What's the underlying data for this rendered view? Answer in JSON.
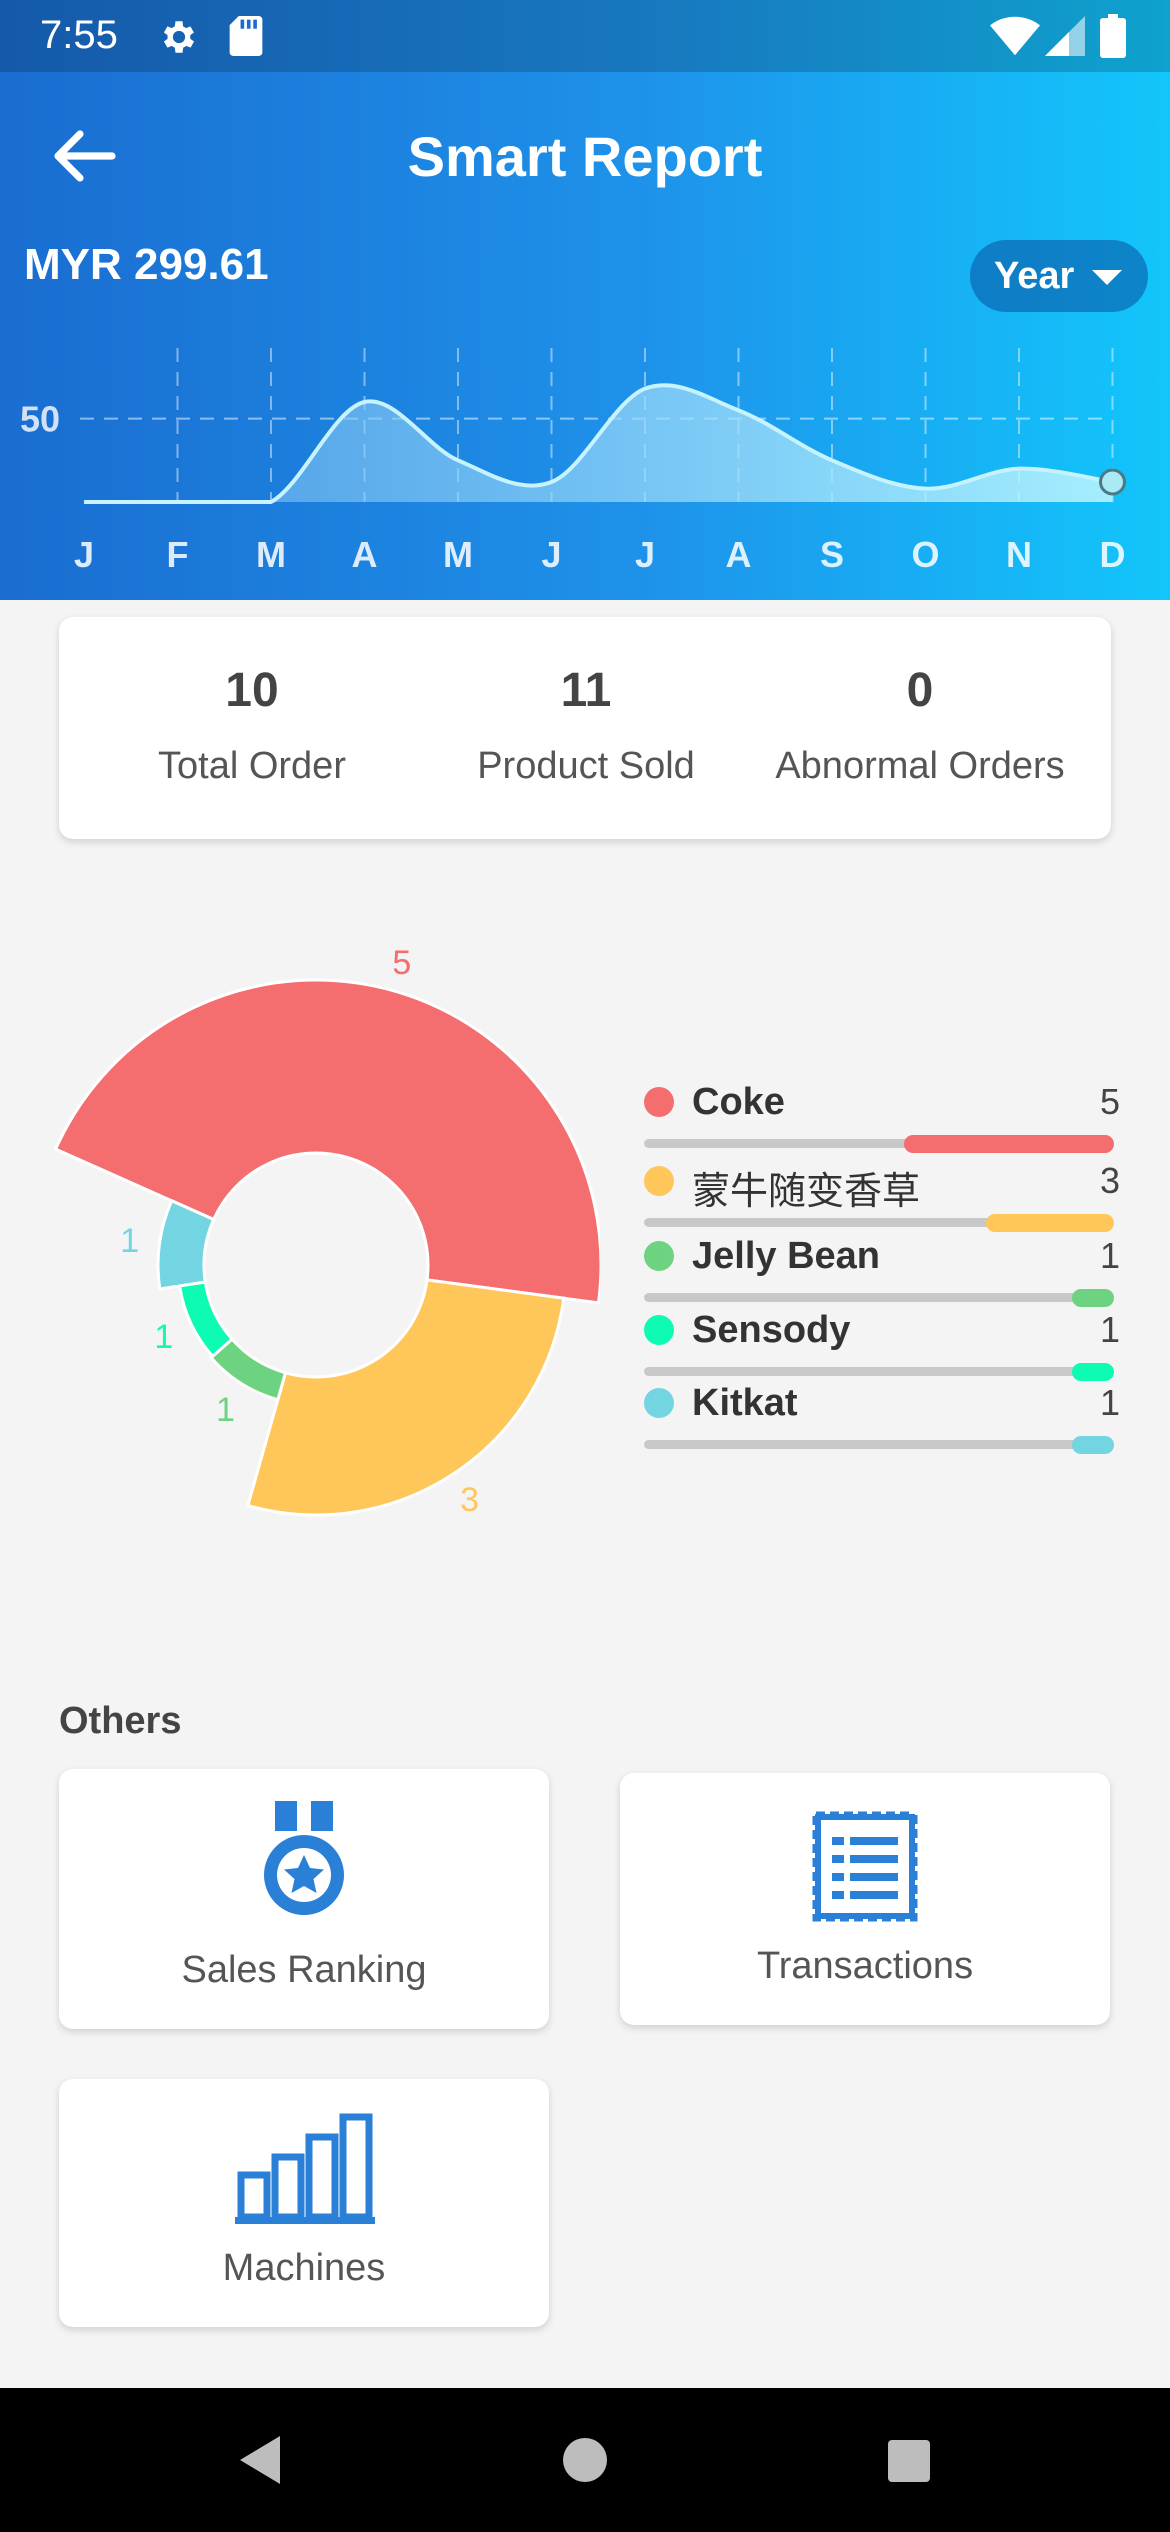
{
  "status_bar": {
    "time": "7:55",
    "icons": [
      "gear-icon",
      "sd-card-icon",
      "wifi-icon",
      "signal-icon",
      "battery-icon"
    ]
  },
  "header": {
    "title": "Smart Report",
    "amount": "MYR 299.61",
    "period": "Year",
    "back_icon": "arrow-left-icon"
  },
  "colors": {
    "header_start": "#1a6dd0",
    "header_end": "#12c6fb",
    "coke": "#f46d6f",
    "mengniu": "#ffc65a",
    "jelly_bean": "#6dd380",
    "sensody": "#0efbb4",
    "kitkat": "#74d5e2",
    "icon_blue": "#2a7fd6"
  },
  "chart_data": [
    {
      "type": "area",
      "categories": [
        "J",
        "F",
        "M",
        "A",
        "M",
        "J",
        "J",
        "A",
        "S",
        "O",
        "N",
        "D"
      ],
      "series": [
        {
          "values": [
            0,
            0,
            0,
            60,
            25,
            12,
            68,
            55,
            25,
            8,
            20,
            12
          ]
        }
      ],
      "y_ticks": [
        "50"
      ],
      "grid": "dashed",
      "title": ""
    },
    {
      "type": "pie",
      "variant": "donut",
      "labels": [
        "Coke",
        "蒙牛随变香草",
        "Jelly Bean",
        "Sensody",
        "Kitkat"
      ],
      "values": [
        5,
        3,
        1,
        1,
        1
      ],
      "colors": [
        "#f46d6f",
        "#ffc65a",
        "#6dd380",
        "#0efbb4",
        "#74d5e2"
      ]
    }
  ],
  "stats": [
    {
      "value": "10",
      "label": "Total Order"
    },
    {
      "value": "11",
      "label": "Product Sold"
    },
    {
      "value": "0",
      "label": "Abnormal Orders"
    }
  ],
  "legend": [
    {
      "name": "Coke",
      "count": "5",
      "color": "#f46d6f",
      "share": 0.45
    },
    {
      "name": "蒙牛随变香草",
      "count": "3",
      "color": "#ffc65a",
      "share": 0.27
    },
    {
      "name": "Jelly Bean",
      "count": "1",
      "color": "#6dd380",
      "share": 0.09
    },
    {
      "name": "Sensody",
      "count": "1",
      "color": "#0efbb4",
      "share": 0.09
    },
    {
      "name": "Kitkat",
      "count": "1",
      "color": "#74d5e2",
      "share": 0.09
    }
  ],
  "others": {
    "heading": "Others",
    "tiles": [
      {
        "label": "Sales Ranking",
        "icon": "medal-icon"
      },
      {
        "label": "Transactions",
        "icon": "receipt-icon"
      },
      {
        "label": "Machines",
        "icon": "bar-chart-icon"
      }
    ]
  },
  "nav": {
    "icons": [
      "back-triangle-icon",
      "home-circle-icon",
      "recents-square-icon"
    ]
  }
}
